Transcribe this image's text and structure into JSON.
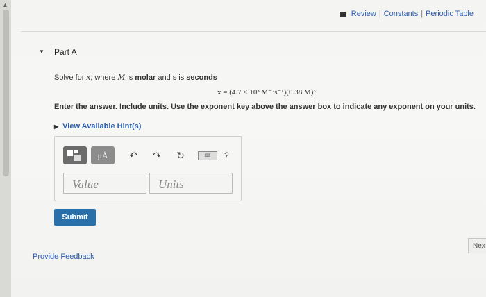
{
  "header": {
    "links": [
      "Review",
      "Constants",
      "Periodic Table"
    ],
    "separator": "|"
  },
  "part": {
    "label": "Part A",
    "question_prefix": "Solve for ",
    "var_x": "x",
    "question_mid": ", where ",
    "var_M": "M",
    "question_is": " is ",
    "molar": "molar",
    "and_s_is": " and s is ",
    "seconds": "seconds",
    "equation": "x = (4.7 × 10³ M⁻²s⁻¹)(0.38 M)³",
    "instructions": "Enter the answer. Include units. Use the exponent key above the answer box to indicate any exponent on your units.",
    "hint_link": "View Available Hint(s)"
  },
  "answer": {
    "units_button": "μÅ",
    "keyboard_label": "⌨",
    "help": "?",
    "value_placeholder": "Value",
    "units_placeholder": "Units"
  },
  "submit_label": "Submit",
  "feedback_link": "Provide Feedback",
  "next_label": "Nex"
}
